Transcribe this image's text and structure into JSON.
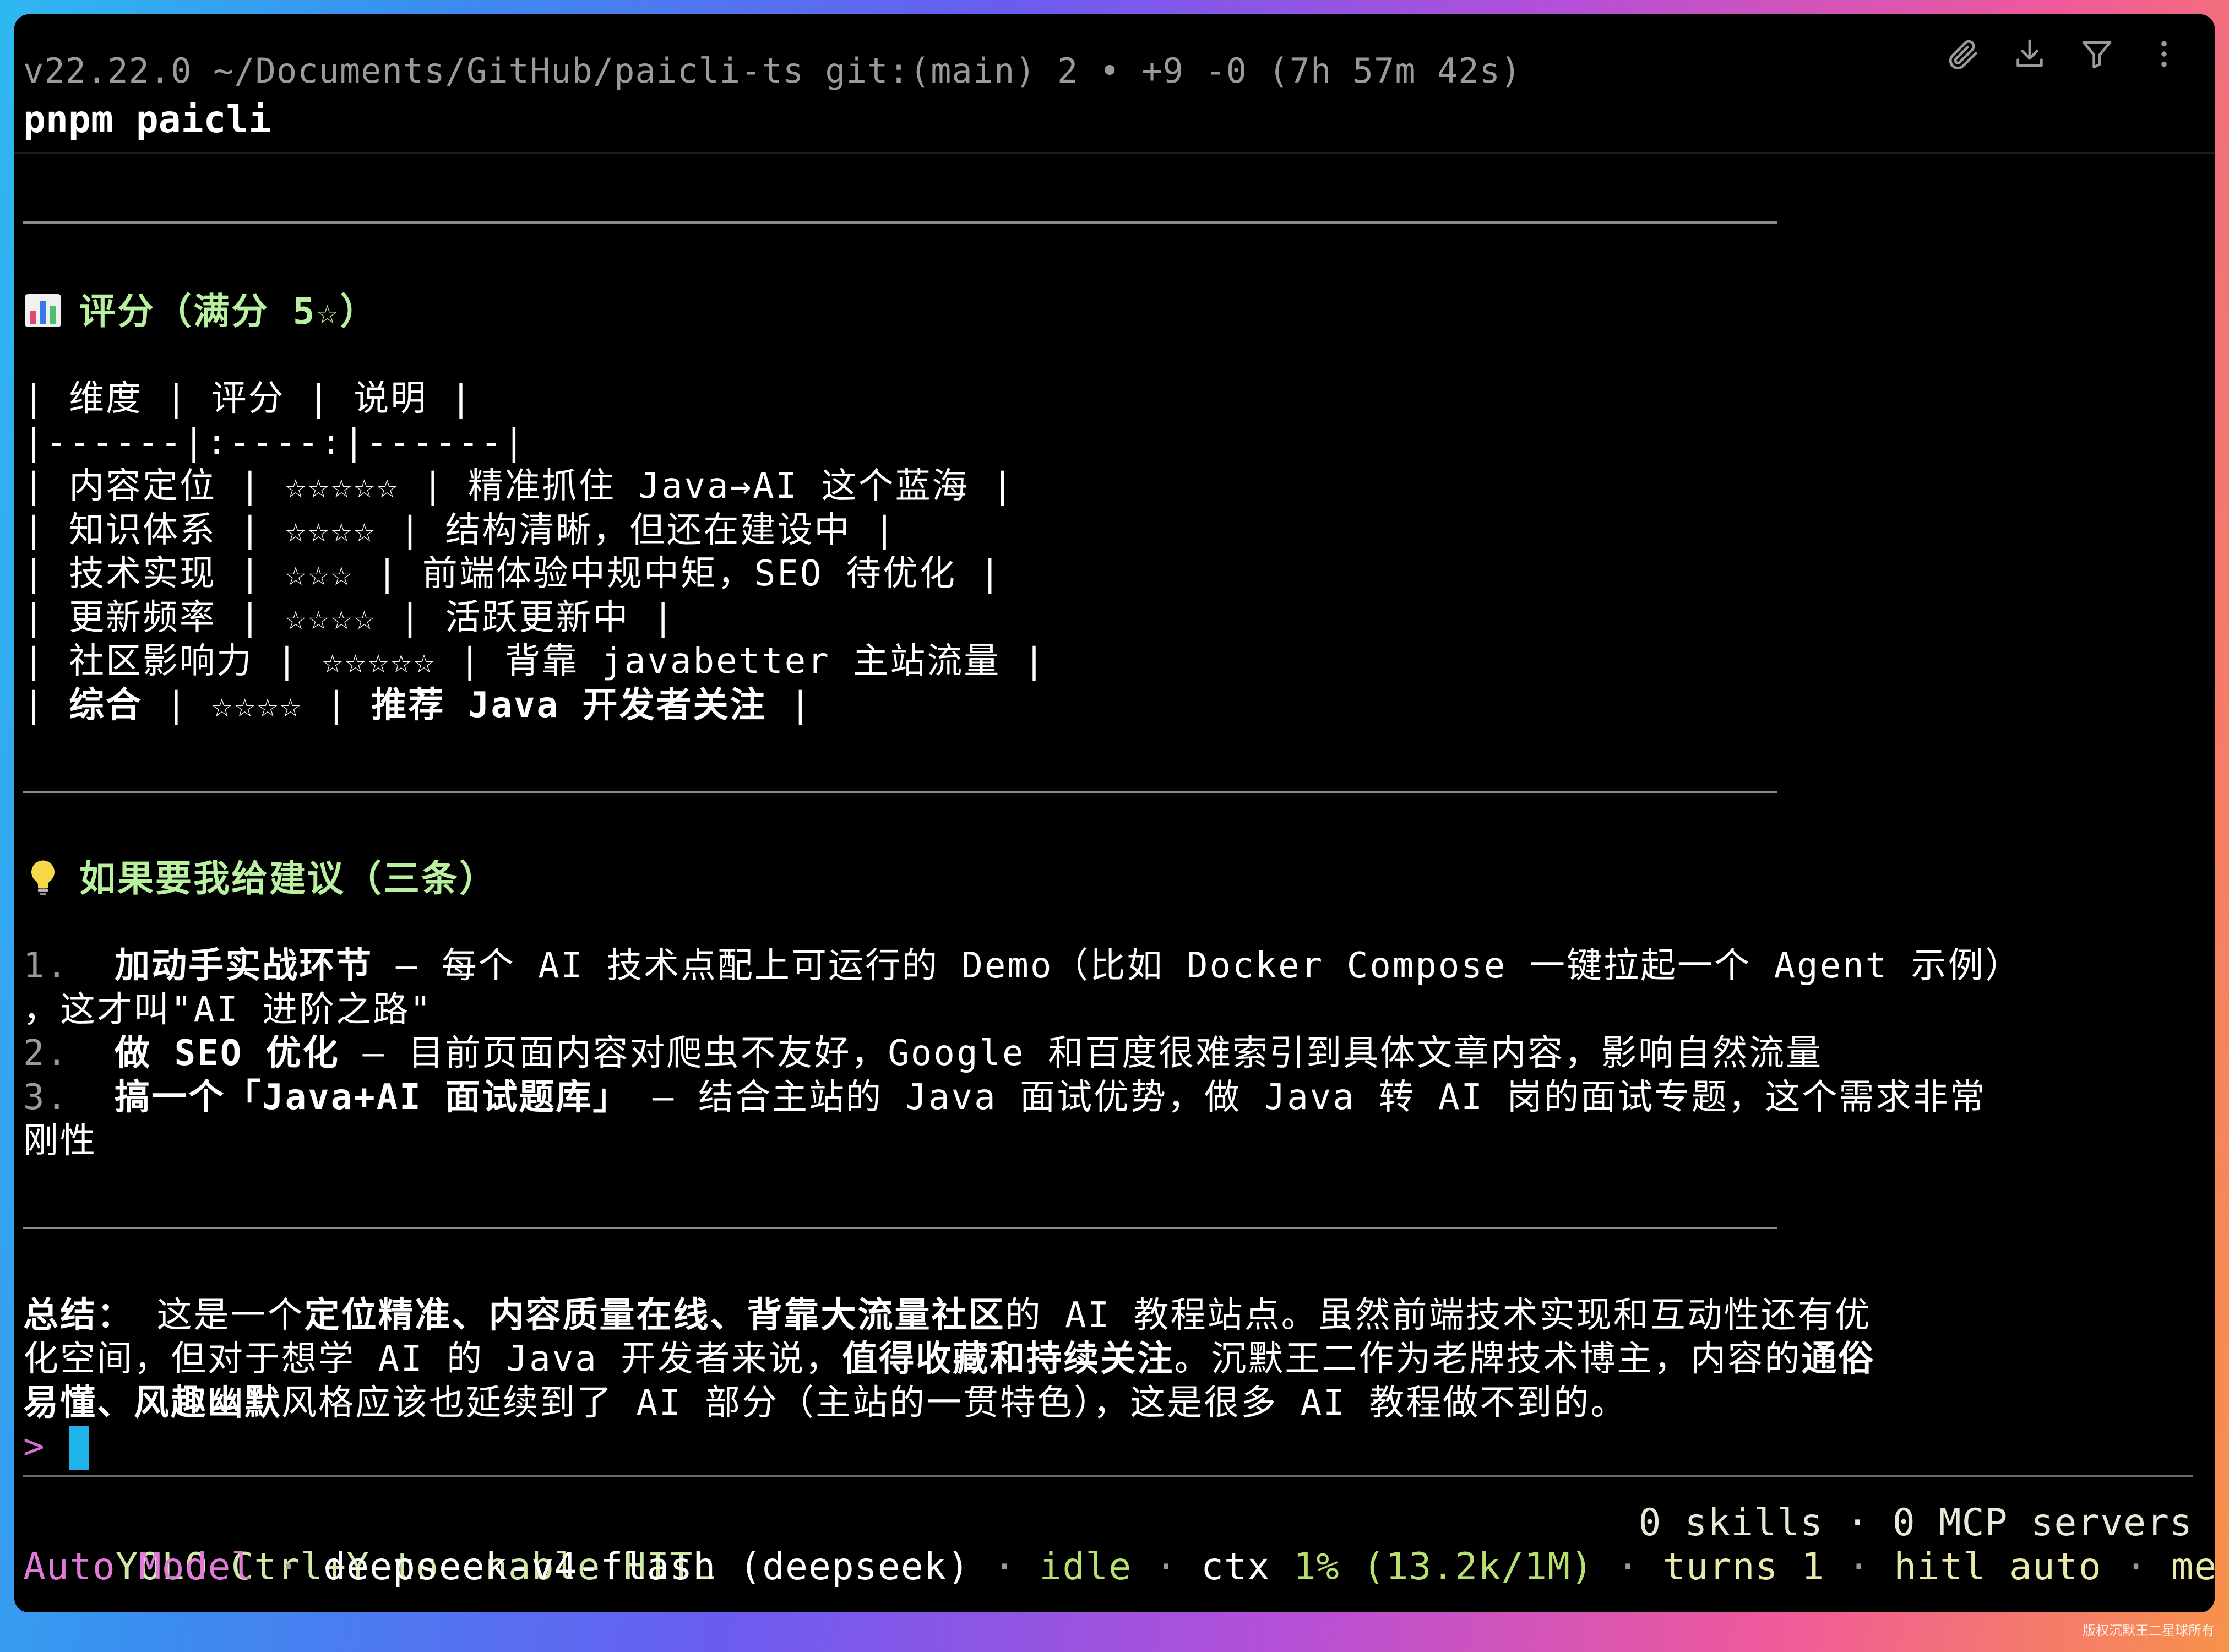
{
  "header": {
    "prompt": "v22.22.0 ~/Documents/GitHub/paicli-ts git:(main) 2 • +9 -0 (7h 57m 42s)",
    "command": "pnpm paicli",
    "icons": [
      "paperclip-icon",
      "download-icon",
      "filter-icon",
      "more-vertical-icon"
    ]
  },
  "rating": {
    "heading": "评分（满分 5☆）",
    "table_lines": [
      "| 维度 | 评分 | 说明 |",
      "|------|:----:|------|",
      "| 内容定位 | ☆☆☆☆☆ | 精准抓住 Java→AI 这个蓝海 |",
      "| 知识体系 | ☆☆☆☆ | 结构清晰，但还在建设中 |",
      "| 技术实现 | ☆☆☆ | 前端体验中规中矩，SEO 待优化 |",
      "| 更新频率 | ☆☆☆☆ | 活跃更新中 |",
      "| 社区影响力 | ☆☆☆☆☆ | 背靠 javabetter 主站流量 |"
    ],
    "summary_row": {
      "p1": "| ",
      "p2": "综合",
      "p3": " | ☆☆☆☆ | ",
      "p4": "推荐 Java 开发者关注",
      "p5": " |"
    }
  },
  "suggestions": {
    "heading": "如果要我给建议（三条）",
    "items": [
      {
        "num": "1.",
        "bold": "加动手实战环节",
        "text": " — 每个 AI 技术点配上可运行的 Demo（比如 Docker Compose 一键拉起一个 Agent 示例）",
        "cont": "，这才叫\"AI 进阶之路\""
      },
      {
        "num": "2.",
        "bold": "做 SEO 优化",
        "text": " — 目前页面内容对爬虫不友好，Google 和百度很难索引到具体文章内容，影响自然流量",
        "cont": ""
      },
      {
        "num": "3.",
        "bold": "搞一个「Java+AI 面试题库」",
        "text": " — 结合主站的 Java 面试优势，做 Java 转 AI 岗的面试专题，这个需求非常",
        "cont": "刚性"
      }
    ]
  },
  "summary": {
    "l1a": "总结：",
    "l1b": " 这是一个",
    "l1c": "定位精准、内容质量在线、背靠大流量社区",
    "l1d": "的 AI 教程站点。虽然前端技术实现和互动性还有优",
    "l2a": "化空间，但对于想学 AI 的 Java 开发者来说，",
    "l2b": "值得收藏和持续关注",
    "l2c": "。沉默王二作为老牌技术博主，内容的",
    "l2d": "通俗",
    "l3a": "易懂、风趣幽默",
    "l3b": "风格应该也延续到了 AI 部分（主站的一贯特色），这是很多 AI 教程做不到的。"
  },
  "input": {
    "prompt_char": ">"
  },
  "status": {
    "mode": "YOLO Ctrl+Y to enable HITL",
    "right": "0 skills · 0 MCP servers",
    "auto_model": "Auto Model",
    "sep": " · ",
    "model": "deepseek-v4-flash (deepseek)",
    "state": "idle",
    "ctx_label": "ctx ",
    "ctx_value": "1% (13.2k/1M)",
    "turns": "turns 1",
    "hitl": "hitl auto",
    "mem": "mem"
  },
  "watermark": "版权沉默王二星球所有"
}
